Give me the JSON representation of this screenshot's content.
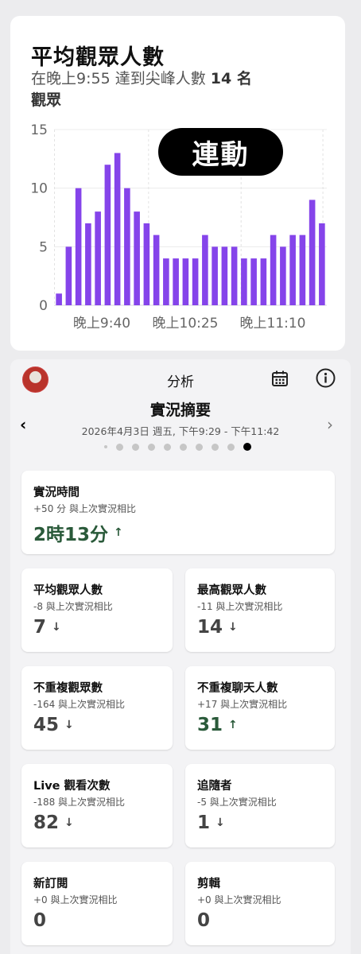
{
  "chart_card": {
    "title": "平均觀眾人數",
    "subtitle_prefix": "在晚上9:55 達到尖峰人數",
    "subtitle_value": "14 名",
    "subtitle_suffix": "觀眾",
    "badge": "連動"
  },
  "chart_data": {
    "type": "bar",
    "color": "#8544ea",
    "ylim": [
      0,
      15
    ],
    "yticks": [
      0,
      5,
      10,
      15
    ],
    "xtick_labels": [
      "晚上9:40",
      "晚上10:25",
      "晚上11:10"
    ],
    "values": [
      1,
      5,
      10,
      7,
      8,
      12,
      13,
      10,
      8,
      7,
      6,
      4,
      4,
      4,
      4,
      6,
      5,
      5,
      5,
      4,
      4,
      4,
      6,
      5,
      6,
      6,
      9,
      7
    ]
  },
  "header": {
    "title": "分析",
    "summary_title": "實況摘要",
    "date_range": "2026年4月3日 週五, 下午9:29 - 下午11:42"
  },
  "pagination": {
    "count": 10,
    "active_index": 9
  },
  "stats": {
    "live_time": {
      "title": "實況時間",
      "compare": "+50 分 與上次實況相比",
      "value": "2時13分",
      "trend": "up"
    },
    "avg_viewers": {
      "title": "平均觀眾人數",
      "compare": "-8 與上次實況相比",
      "value": "7",
      "trend": "down"
    },
    "max_viewers": {
      "title": "最高觀眾人數",
      "compare": "-11 與上次實況相比",
      "value": "14",
      "trend": "down"
    },
    "unique_viewers": {
      "title": "不重複觀眾數",
      "compare": "-164 與上次實況相比",
      "value": "45",
      "trend": "down"
    },
    "unique_chatters": {
      "title": "不重複聊天人數",
      "compare": "+17 與上次實況相比",
      "value": "31",
      "trend": "up"
    },
    "live_views": {
      "title": "Live 觀看次數",
      "compare": "-188 與上次實況相比",
      "value": "82",
      "trend": "down"
    },
    "followers": {
      "title": "追隨者",
      "compare": "-5 與上次實況相比",
      "value": "1",
      "trend": "down"
    },
    "new_subs": {
      "title": "新訂閱",
      "compare": "+0 與上次實況相比",
      "value": "0",
      "trend": "none"
    },
    "clips": {
      "title": "剪輯",
      "compare": "+0 與上次實況相比",
      "value": "0",
      "trend": "none"
    }
  },
  "icons": {
    "up": "↑",
    "down": "↓"
  }
}
